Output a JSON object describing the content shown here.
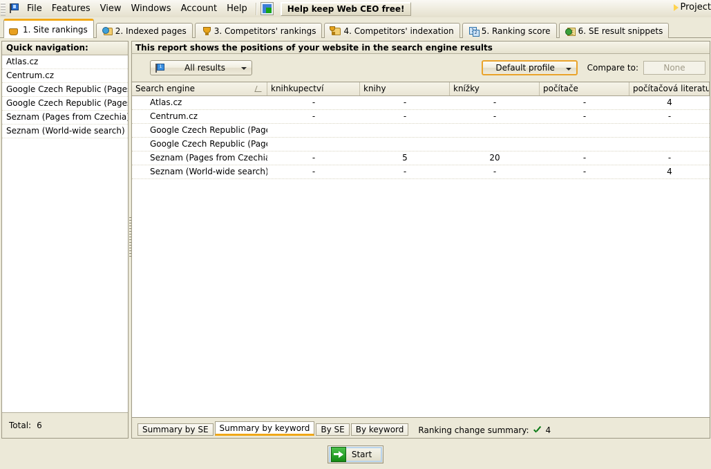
{
  "menubar": {
    "app_icon": "flag-icon",
    "items": [
      "File",
      "Features",
      "View",
      "Windows",
      "Account",
      "Help"
    ],
    "toolbar_icon": "export-window-icon",
    "help_button": "Help keep Web CEO free!",
    "project_menu": "Project"
  },
  "tabs": [
    {
      "label": "1. Site rankings",
      "icon": "globe-icon",
      "active": true
    },
    {
      "label": "2. Indexed pages",
      "icon": "indexed-pages-icon",
      "active": false
    },
    {
      "label": "3. Competitors' rankings",
      "icon": "trophy-icon",
      "active": false
    },
    {
      "label": "4. Competitors' indexation",
      "icon": "competitors-indexation-icon",
      "active": false
    },
    {
      "label": "5. Ranking score",
      "icon": "ranking-score-icon",
      "active": false
    },
    {
      "label": "6. SE result snippets",
      "icon": "snippets-icon",
      "active": false
    }
  ],
  "sidebar": {
    "header": "Quick navigation:",
    "items": [
      "Atlas.cz",
      "Centrum.cz",
      "Google Czech Republic (Pages fro...",
      "Google Czech Republic (Pages in ...",
      "Seznam (Pages from Czechia)",
      "Seznam (World-wide search)"
    ],
    "total_label": "Total:",
    "total_value": "6"
  },
  "report": {
    "title": "This report shows the positions of your website in the search engine results",
    "results_filter": "All results",
    "results_filter_icon": "flag-1-icon",
    "profile": "Default profile",
    "compare_label": "Compare to:",
    "compare_value": "None"
  },
  "grid": {
    "columns": [
      {
        "label": "Search engine",
        "sorted": true
      },
      {
        "label": "knihkupectví",
        "sorted": false
      },
      {
        "label": "knihy",
        "sorted": false
      },
      {
        "label": "knížky",
        "sorted": false
      },
      {
        "label": "počítače",
        "sorted": false
      },
      {
        "label": "počítačová literatura",
        "sorted": false
      }
    ],
    "rows": [
      {
        "name": "Atlas.cz",
        "values": [
          "-",
          "-",
          "-",
          "-",
          "4"
        ]
      },
      {
        "name": "Centrum.cz",
        "values": [
          "-",
          "-",
          "-",
          "-",
          "-"
        ]
      },
      {
        "name": "Google Czech Republic (Pages fro...",
        "values": [
          "",
          "",
          "",
          "",
          ""
        ]
      },
      {
        "name": "Google Czech Republic (Pages in ...",
        "values": [
          "",
          "",
          "",
          "",
          ""
        ]
      },
      {
        "name": "Seznam (Pages from Czechia)",
        "values": [
          "-",
          "5",
          "20",
          "-",
          "-"
        ]
      },
      {
        "name": "Seznam (World-wide search)",
        "values": [
          "-",
          "-",
          "-",
          "-",
          "4"
        ]
      }
    ]
  },
  "bottom_tabs": [
    {
      "label": "Summary by SE",
      "active": false
    },
    {
      "label": "Summary by keyword",
      "active": true
    },
    {
      "label": "By SE",
      "active": false
    },
    {
      "label": "By keyword",
      "active": false
    }
  ],
  "status": {
    "ranking_change_label": "Ranking change summary:",
    "ranking_change_icon": "green-check-icon",
    "ranking_change_value": "4"
  },
  "footer": {
    "start_label": "Start",
    "start_icon": "green-arrow-icon"
  },
  "colors": {
    "window_bg": "#ece9d8",
    "accent_orange": "#f0a818",
    "profile_highlight": "#e9a32a",
    "grid_bg": "#ffffff",
    "check_green": "#0a7a15"
  }
}
